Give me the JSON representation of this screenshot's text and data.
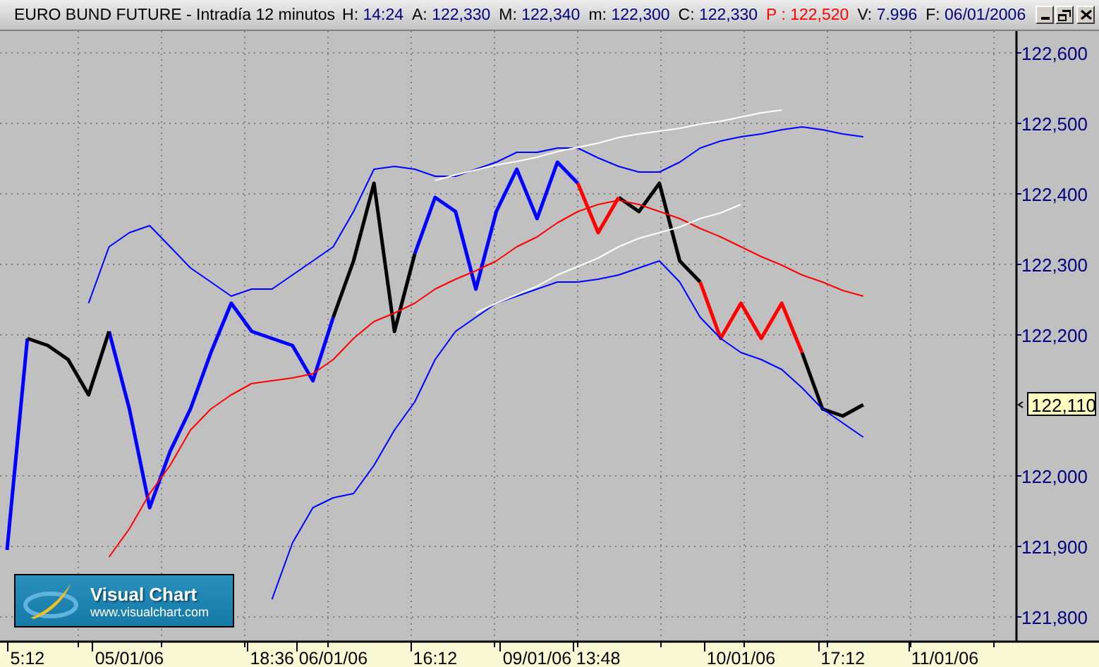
{
  "window": {
    "title": "EURO BUND FUTURE - Intradía 12 minutos",
    "quote": [
      {
        "label": "H:",
        "value": "14:24",
        "kind": "normal"
      },
      {
        "label": "A:",
        "value": "122,330",
        "kind": "normal"
      },
      {
        "label": "M:",
        "value": "122,340",
        "kind": "normal"
      },
      {
        "label": "m:",
        "value": "122,300",
        "kind": "normal"
      },
      {
        "label": "C:",
        "value": "122,330",
        "kind": "normal"
      },
      {
        "label": "P :",
        "value": "122,520",
        "kind": "highlight"
      },
      {
        "label": "V:",
        "value": "7.996",
        "kind": "normal"
      },
      {
        "label": "F:",
        "value": "06/01/2006",
        "kind": "normal"
      }
    ]
  },
  "chart": {
    "last_price": "122,110",
    "chart_data": {
      "type": "line",
      "categories": [
        null,
        "5:12",
        null,
        null,
        null,
        null,
        "05/01/06",
        null,
        null,
        null,
        null,
        null,
        null,
        "18:36",
        null,
        null,
        "06/01/06",
        null,
        null,
        null,
        null,
        "16:12",
        null,
        null,
        null,
        null,
        "09/01/06",
        null,
        null,
        "13:48",
        null,
        null,
        null,
        null,
        null,
        null,
        "10/01/06",
        null,
        null,
        null,
        null,
        "17:12",
        null,
        null,
        null,
        null,
        "11/01/06",
        null,
        null,
        null
      ],
      "ylim": [
        121764,
        122630
      ],
      "grid": true,
      "series": [
        {
          "color": "#0000ff",
          "values": [
            121894,
            122194,
            null,
            null,
            null,
            122204,
            122094,
            121954,
            122034,
            122094,
            122174,
            122244,
            122204,
            122194,
            122184,
            122134,
            122224,
            null,
            null,
            null,
            122314,
            122394,
            122374,
            122264,
            122374,
            122434,
            122364,
            122444,
            122414,
            null,
            null,
            null,
            null,
            null,
            null,
            null,
            null,
            null,
            null,
            null,
            null,
            null,
            null,
            null,
            null,
            null,
            null,
            null,
            null,
            null
          ]
        },
        {
          "color": "#000000",
          "values": [
            null,
            122194,
            122184,
            122164,
            122114,
            122204,
            null,
            null,
            null,
            null,
            null,
            null,
            null,
            null,
            null,
            null,
            122224,
            122304,
            122414,
            122204,
            122314,
            null,
            null,
            null,
            null,
            null,
            null,
            null,
            null,
            null,
            122394,
            122374,
            122414,
            122304,
            122274,
            null,
            null,
            null,
            null,
            122174,
            122094,
            122084,
            122100,
            null,
            null,
            null,
            null,
            null,
            null,
            null
          ]
        },
        {
          "color": "#ff0000",
          "values": [
            null,
            null,
            null,
            null,
            null,
            null,
            null,
            null,
            null,
            null,
            null,
            null,
            null,
            null,
            null,
            null,
            null,
            null,
            null,
            null,
            null,
            null,
            null,
            null,
            null,
            null,
            null,
            null,
            122414,
            122344,
            122394,
            null,
            null,
            null,
            122274,
            122194,
            122244,
            122194,
            122244,
            122174,
            null,
            null,
            null,
            null,
            null,
            null,
            null,
            null,
            null,
            null
          ]
        },
        {
          "color": "#0000ff",
          "values": [
            null,
            null,
            null,
            null,
            122244,
            122324,
            122344,
            122354,
            122324,
            122294,
            122274,
            122254,
            122264,
            122264,
            122284,
            122304,
            122324,
            122374,
            122434,
            122438,
            122434,
            122424,
            122424,
            122434,
            122444,
            122458,
            122458,
            122464,
            122464,
            122450,
            122438,
            122430,
            122430,
            122444,
            122464,
            122474,
            122480,
            122484,
            122490,
            122494,
            122490,
            122484,
            122480,
            null,
            null,
            null,
            null,
            null,
            null,
            null
          ]
        },
        {
          "color": "#0000ff",
          "values": [
            null,
            null,
            null,
            null,
            null,
            null,
            null,
            null,
            null,
            null,
            null,
            null,
            null,
            121824,
            121904,
            121954,
            121968,
            121974,
            122014,
            122064,
            122104,
            122164,
            122204,
            122224,
            122244,
            122254,
            122264,
            122274,
            122274,
            122278,
            122284,
            122294,
            122304,
            122274,
            122224,
            122194,
            122174,
            122164,
            122150,
            122124,
            122094,
            122074,
            122054,
            null,
            null,
            null,
            null,
            null,
            null,
            null
          ]
        },
        {
          "color": "#ff0000",
          "values": [
            null,
            null,
            null,
            null,
            null,
            121884,
            121924,
            121974,
            122014,
            122064,
            122094,
            122114,
            122130,
            122134,
            122138,
            122144,
            122164,
            122194,
            122218,
            122230,
            122244,
            122264,
            122278,
            122290,
            122304,
            122324,
            122338,
            122358,
            122374,
            122384,
            122390,
            122384,
            122374,
            122364,
            122350,
            122338,
            122324,
            122310,
            122298,
            122284,
            122274,
            122262,
            122254,
            null,
            null,
            null,
            null,
            null,
            null,
            null
          ]
        },
        {
          "color": "#ffffff",
          "values": [
            null,
            null,
            null,
            null,
            null,
            null,
            null,
            null,
            null,
            null,
            null,
            null,
            null,
            null,
            null,
            null,
            null,
            null,
            null,
            null,
            null,
            122418,
            122426,
            122433,
            122440,
            122445,
            122451,
            122459,
            122465,
            122471,
            122479,
            122484,
            122488,
            122492,
            122498,
            122502,
            122508,
            122514,
            122518,
            null,
            null,
            null,
            null,
            null,
            null,
            null,
            null,
            null,
            null,
            null
          ]
        },
        {
          "color": "#ffffff",
          "values": [
            null,
            null,
            null,
            null,
            null,
            null,
            null,
            null,
            null,
            null,
            null,
            null,
            null,
            null,
            null,
            null,
            null,
            null,
            null,
            null,
            null,
            null,
            null,
            122230,
            122244,
            122256,
            122268,
            122284,
            122296,
            122308,
            122324,
            122336,
            122344,
            122352,
            122364,
            122372,
            122384,
            null,
            null,
            null,
            null,
            null,
            null,
            null,
            null,
            null,
            null,
            null,
            null,
            null
          ]
        }
      ],
      "yticks": [
        {
          "value": 122600,
          "label": "122,600"
        },
        {
          "value": 122500,
          "label": "122,500"
        },
        {
          "value": 122400,
          "label": "122,400"
        },
        {
          "value": 122300,
          "label": "122,300"
        },
        {
          "value": 122200,
          "label": "122,200"
        },
        {
          "value": 122000,
          "label": "122,000"
        },
        {
          "value": 121900,
          "label": "121,900"
        },
        {
          "value": 121800,
          "label": "121,800"
        }
      ]
    }
  },
  "logo": {
    "name": "Visual Chart",
    "url": "www.visualchart.com"
  }
}
